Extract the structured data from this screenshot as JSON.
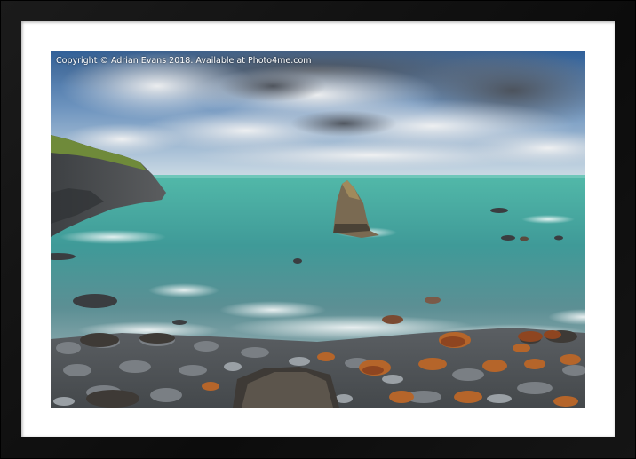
{
  "watermark": {
    "text": "Copyright  © Adrian Evans  2018. Available at Photo4me.com"
  },
  "colors": {
    "frame": "#111111",
    "mount": "#ffffff",
    "sky_blue": "#3c74b4",
    "sea": "#3c9a98",
    "rocks": "#6a6e72",
    "rust_rocks": "#b5652a"
  },
  "scene": "sea stack seascape with cliff headland and pebble beach"
}
